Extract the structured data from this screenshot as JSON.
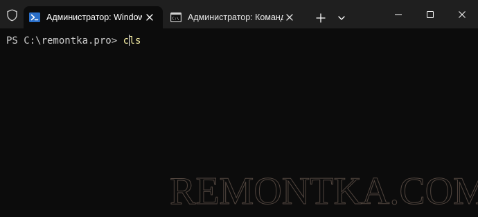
{
  "tabs": [
    {
      "title": "Администратор: Windows PowerShell",
      "icon": "powershell-icon",
      "active": true
    },
    {
      "title": "Администратор: Командная строка",
      "icon": "cmd-icon",
      "active": false
    }
  ],
  "terminal": {
    "prompt": "PS C:\\remontka.pro> ",
    "command_part1": "c",
    "command_part2": "ls"
  },
  "watermark": "REMONTKA.COM",
  "colors": {
    "titlebar": "#1f1f1f",
    "terminal_bg": "#0c0c0c",
    "prompt_text": "#cccccc",
    "command_text": "#f9f1a5"
  }
}
